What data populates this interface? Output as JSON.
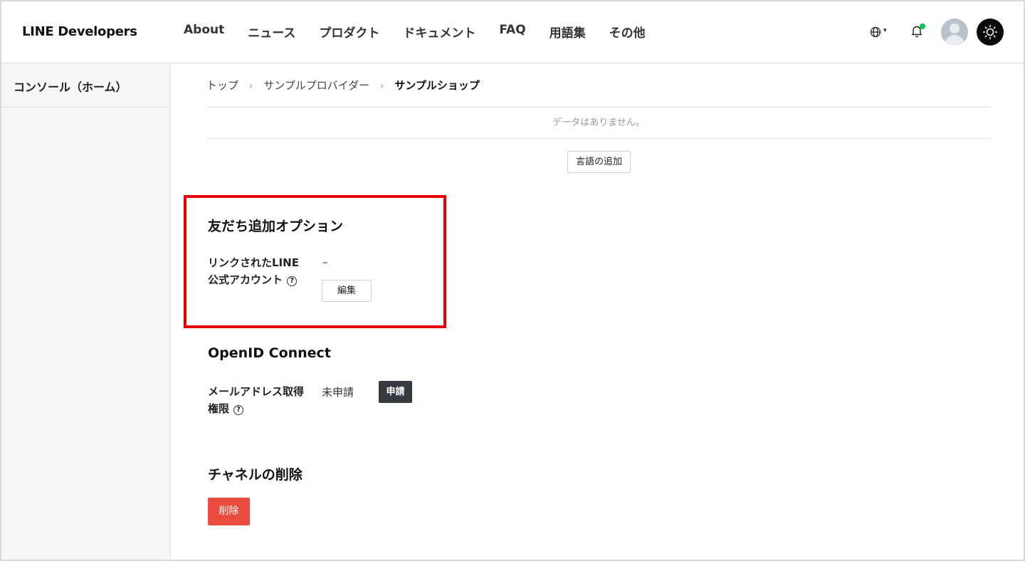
{
  "header": {
    "logo": "LINE Developers",
    "nav": [
      "About",
      "ニュース",
      "プロダクト",
      "ドキュメント",
      "FAQ",
      "用語集",
      "その他"
    ],
    "globe_caret": "▾"
  },
  "sidebar": {
    "items": [
      {
        "label": "コンソール（ホーム）"
      }
    ]
  },
  "breadcrumb": {
    "items": [
      "トップ",
      "サンプルプロバイダー",
      "サンプルショップ"
    ],
    "separator": "›"
  },
  "language_table": {
    "empty_text": "データはありません。",
    "add_button": "言語の追加"
  },
  "friend_option": {
    "title": "友だち追加オプション",
    "label_line1": "リンクされたLINE",
    "label_line2": "公式アカウント",
    "help": "?",
    "value": "–",
    "edit_button": "編集"
  },
  "openid": {
    "title": "OpenID Connect",
    "label_line1": "メールアドレス取得",
    "label_line2": "権限",
    "help": "?",
    "value": "未申請",
    "apply_button": "申請"
  },
  "delete_channel": {
    "title": "チャネルの削除",
    "button": "削除"
  },
  "colors": {
    "highlight": "#e60000",
    "delete": "#e94c3d",
    "apply": "#343a40",
    "notification_dot": "#06c755"
  },
  "icons": [
    "globe-icon",
    "bell-icon",
    "avatar-icon",
    "sun-icon",
    "help-icon"
  ]
}
